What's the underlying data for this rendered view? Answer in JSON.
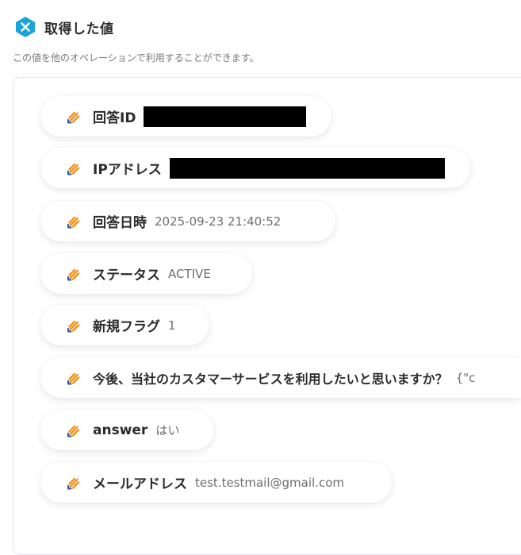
{
  "header": {
    "title": "取得した値",
    "description": "この値を他のオペレーションで利用することができます。"
  },
  "colors": {
    "accent": "#1aa4d8",
    "chip_bg": "#ffffff",
    "redaction": "#000000"
  },
  "items": [
    {
      "label": "回答ID",
      "value": "",
      "redacted": true,
      "icon": "pencil-icon"
    },
    {
      "label": "IPアドレス",
      "value": "",
      "redacted": true,
      "icon": "pencil-icon"
    },
    {
      "label": "回答日時",
      "value": "2025-09-23 21:40:52",
      "icon": "pencil-icon"
    },
    {
      "label": "ステータス",
      "value": "ACTIVE",
      "icon": "pencil-icon"
    },
    {
      "label": "新規フラグ",
      "value": "1",
      "icon": "pencil-icon"
    },
    {
      "label": "今後、当社のカスタマーサービスを利用したいと思いますか？",
      "value": "{\"c",
      "icon": "pencil-icon"
    },
    {
      "label": "answer",
      "value": "はい",
      "icon": "pencil-icon"
    },
    {
      "label": "メールアドレス",
      "value": "test.testmail@gmail.com",
      "icon": "pencil-icon"
    }
  ]
}
